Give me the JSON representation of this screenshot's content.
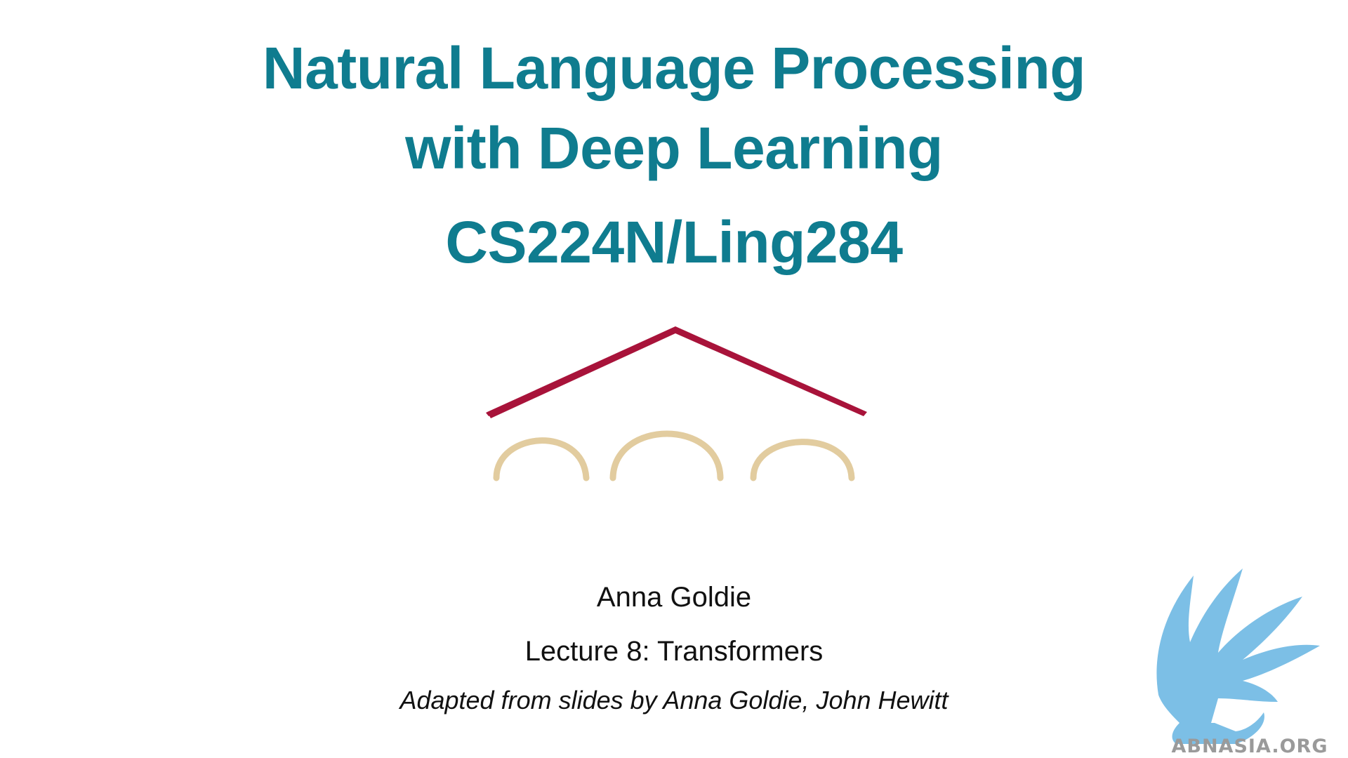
{
  "slide": {
    "title_line1": "Natural Language Processing",
    "title_line2": "with Deep Learning",
    "course_code": "CS224N/Ling284",
    "author": "Anna Goldie",
    "lecture": "Lecture 8: Transformers",
    "adapted_from": "Adapted from slides by Anna Goldie, John Hewitt"
  },
  "logo": {
    "icon": "stanford-arches-logo",
    "roof_color": "#a8133a",
    "arch_color": "#e2cc9f"
  },
  "watermark": {
    "icon": "griffin-watermark",
    "text": "ABNASIA.ORG",
    "color": "#7cbfe6"
  },
  "colors": {
    "title": "#0f7c8f",
    "body_text": "#111111",
    "background": "#ffffff"
  }
}
